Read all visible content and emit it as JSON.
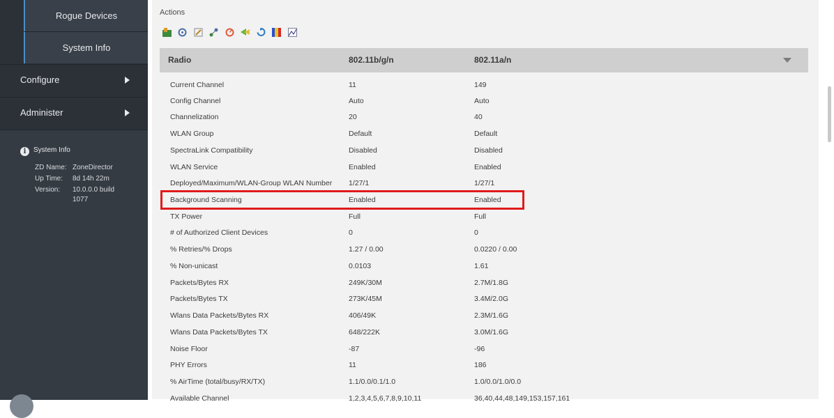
{
  "sidebar": {
    "sub_items": [
      {
        "label": "Rogue Devices"
      },
      {
        "label": "System Info"
      }
    ],
    "main_items": [
      {
        "label": "Configure"
      },
      {
        "label": "Administer"
      }
    ],
    "system_info": {
      "title": "System Info",
      "zd_name_label": "ZD Name:",
      "zd_name": "ZoneDirector",
      "uptime_label": "Up Time:",
      "uptime": "8d 14h 22m",
      "version_label": "Version:",
      "version_line1": "10.0.0.0 build",
      "version_line2": "1077"
    }
  },
  "actions": {
    "label": "Actions",
    "icons": [
      "map-icon",
      "ping-icon",
      "edit-icon",
      "speedflex-icon",
      "spectrum-icon",
      "tunnel-icon",
      "restart-icon",
      "spectrum-analysis-icon",
      "chart-icon"
    ]
  },
  "radio_table": {
    "headers": [
      "Radio",
      "802.11b/g/n",
      "802.11a/n"
    ],
    "rows": [
      [
        "Current Channel",
        "11",
        "149"
      ],
      [
        "Config Channel",
        "Auto",
        "Auto"
      ],
      [
        "Channelization",
        "20",
        "40"
      ],
      [
        "WLAN Group",
        "Default",
        "Default"
      ],
      [
        "SpectraLink Compatibility",
        "Disabled",
        "Disabled"
      ],
      [
        "WLAN Service",
        "Enabled",
        "Enabled"
      ],
      [
        "Deployed/Maximum/WLAN-Group WLAN Number",
        "1/27/1",
        "1/27/1"
      ],
      [
        "Background Scanning",
        "Enabled",
        "Enabled"
      ],
      [
        "TX Power",
        "Full",
        "Full"
      ],
      [
        "# of Authorized Client Devices",
        "0",
        "0"
      ],
      [
        "% Retries/% Drops",
        "1.27 / 0.00",
        "0.0220 / 0.00"
      ],
      [
        "% Non-unicast",
        "0.0103",
        "1.61"
      ],
      [
        "Packets/Bytes RX",
        "249K/30M",
        "2.7M/1.8G"
      ],
      [
        "Packets/Bytes TX",
        "273K/45M",
        "3.4M/2.0G"
      ],
      [
        "Wlans Data Packets/Bytes RX",
        "406/49K",
        "2.3M/1.6G"
      ],
      [
        "Wlans Data Packets/Bytes TX",
        "648/222K",
        "3.0M/1.6G"
      ],
      [
        "Noise Floor",
        "-87",
        "-96"
      ],
      [
        "PHY Errors",
        "11",
        "186"
      ],
      [
        "% AirTime (total/busy/RX/TX)",
        "1.1/0.0/0.1/1.0",
        "1.0/0.0/1.0/0.0"
      ],
      [
        "Available Channel",
        "1,2,3,4,5,6,7,8,9,10,11",
        "36,40,44,48,149,153,157,161"
      ]
    ]
  },
  "colors": {
    "sidebar_bg": "#2c3138",
    "highlight_border": "#e01a1a",
    "header_bg": "#cfcfcf"
  }
}
